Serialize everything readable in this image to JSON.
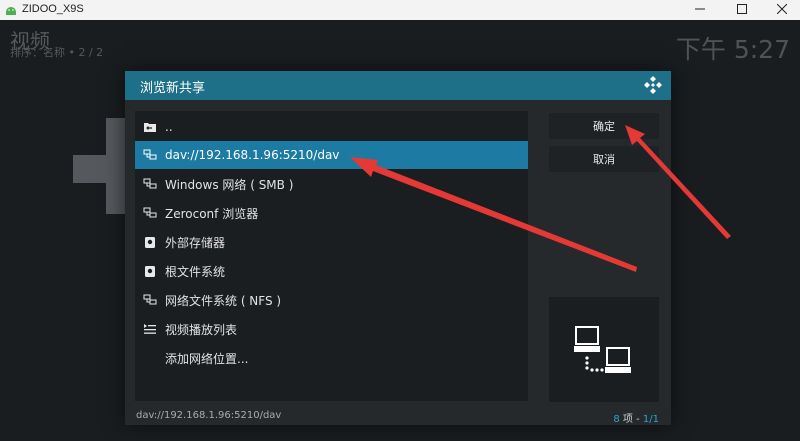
{
  "window": {
    "title": "ZIDOO_X9S",
    "icon": "android-icon",
    "controls": [
      "minimize-icon",
      "maximize-icon",
      "close-icon"
    ]
  },
  "background": {
    "section_title": "视频",
    "sort_info": "排序：名称  •  2 / 2",
    "clock": "下午 5:27"
  },
  "dialog": {
    "title": "浏览新共享",
    "header_color": "#1e6f88",
    "items": [
      {
        "label": "..",
        "icon": "folder-back-icon"
      },
      {
        "label": "dav://192.168.1.96:5210/dav",
        "icon": "network-icon",
        "selected": true
      },
      {
        "label": "Windows 网络 ( SMB )",
        "icon": "network-icon"
      },
      {
        "label": "Zeroconf 浏览器",
        "icon": "network-icon"
      },
      {
        "label": "外部存储器",
        "icon": "drive-icon"
      },
      {
        "label": "根文件系统",
        "icon": "drive-icon"
      },
      {
        "label": "网络文件系统 ( NFS )",
        "icon": "network-icon"
      },
      {
        "label": "视频播放列表",
        "icon": "playlist-icon"
      },
      {
        "label": "添加网络位置...",
        "icon": ""
      }
    ],
    "buttons": {
      "ok": "确定",
      "cancel": "取消"
    },
    "footer_path": "dav://192.168.1.96:5210/dav",
    "footer_count_num": "8",
    "footer_count_label": " 项 - ",
    "footer_page": "1/1",
    "accent_color": "#1d7aa2",
    "annotation_color": "#e53935"
  }
}
